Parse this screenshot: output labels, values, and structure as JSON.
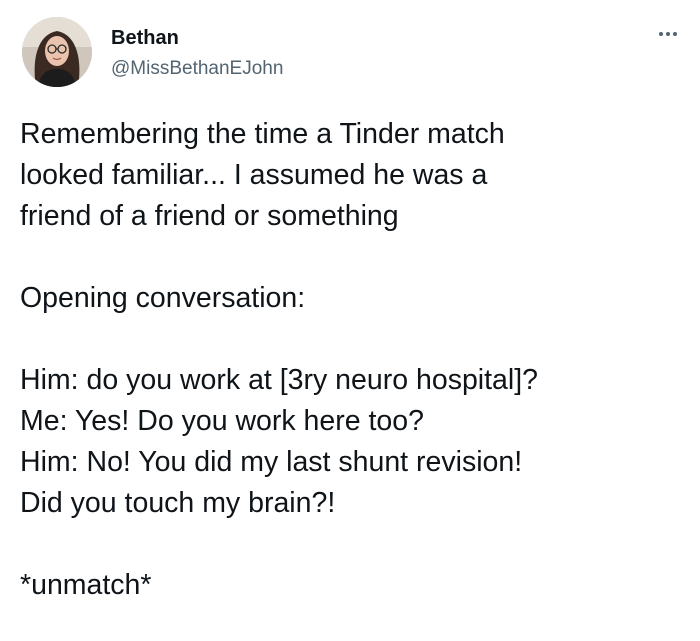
{
  "author": {
    "name": "Bethan",
    "handle": "@MissBethanEJohn",
    "avatar_icon": "profile-photo-avatar"
  },
  "more_icon": "more-options-icon",
  "tweet": {
    "paragraphs": [
      [
        "Remembering the time a Tinder match",
        "looked familiar... I assumed he was a",
        "friend of a friend or something"
      ],
      [
        "Opening conversation:"
      ],
      [
        "Him: do you work at [3ry neuro hospital]?",
        "Me: Yes! Do you work here too?",
        "Him: No! You did my last shunt revision!",
        "Did you touch my brain?!"
      ],
      [
        "*unmatch*"
      ]
    ]
  },
  "colors": {
    "text": "#0f1419",
    "secondary": "#536471",
    "background": "#ffffff"
  }
}
